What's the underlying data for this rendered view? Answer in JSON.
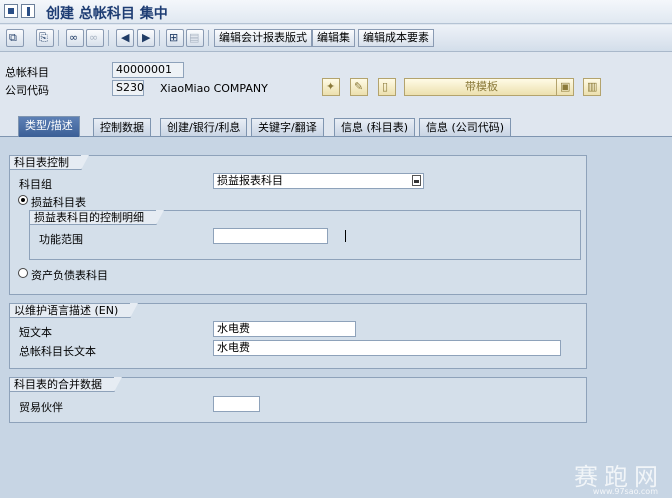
{
  "window": {
    "title": "创建 总帐科目 集中"
  },
  "toolbar": {
    "buttons": [
      "edit-layout",
      "copy",
      "display-change",
      "change-doc",
      "prev",
      "next",
      "template",
      "print"
    ],
    "text_buttons": [
      "编辑会计报表版式",
      "编辑集",
      "编辑成本要素"
    ]
  },
  "header": {
    "gl_account_label": "总帐科目",
    "gl_account_value": "40000001",
    "company_code_label": "公司代码",
    "company_code_value": "S230",
    "company_name": "XiaoMiao COMPANY",
    "template_button": "带模板"
  },
  "tabs": [
    {
      "label": "类型/描述",
      "active": true
    },
    {
      "label": "控制数据",
      "active": false
    },
    {
      "label": "创建/银行/利息",
      "active": false
    },
    {
      "label": "关键字/翻译",
      "active": false
    },
    {
      "label": "信息 (科目表)",
      "active": false
    },
    {
      "label": "信息 (公司代码)",
      "active": false
    }
  ],
  "coa_control": {
    "title": "科目表控制",
    "account_group_label": "科目组",
    "account_group_value": "损益报表科目",
    "pl_radio_label": "损益科目表",
    "pl_detail": {
      "title": "损益表科目的控制明细",
      "functional_area_label": "功能范围",
      "functional_area_value": ""
    },
    "bs_radio_label": "资产负债表科目"
  },
  "description": {
    "title": "以维护语言描述 (EN)",
    "short_text_label": "短文本",
    "short_text_value": "水电费",
    "long_text_label": "总帐科目长文本",
    "long_text_value": "水电费"
  },
  "consolidation": {
    "title": "科目表的合并数据",
    "trading_partner_label": "贸易伙伴",
    "trading_partner_value": ""
  },
  "watermark": {
    "text": "赛跑网",
    "sub": "www.97sao.com"
  }
}
